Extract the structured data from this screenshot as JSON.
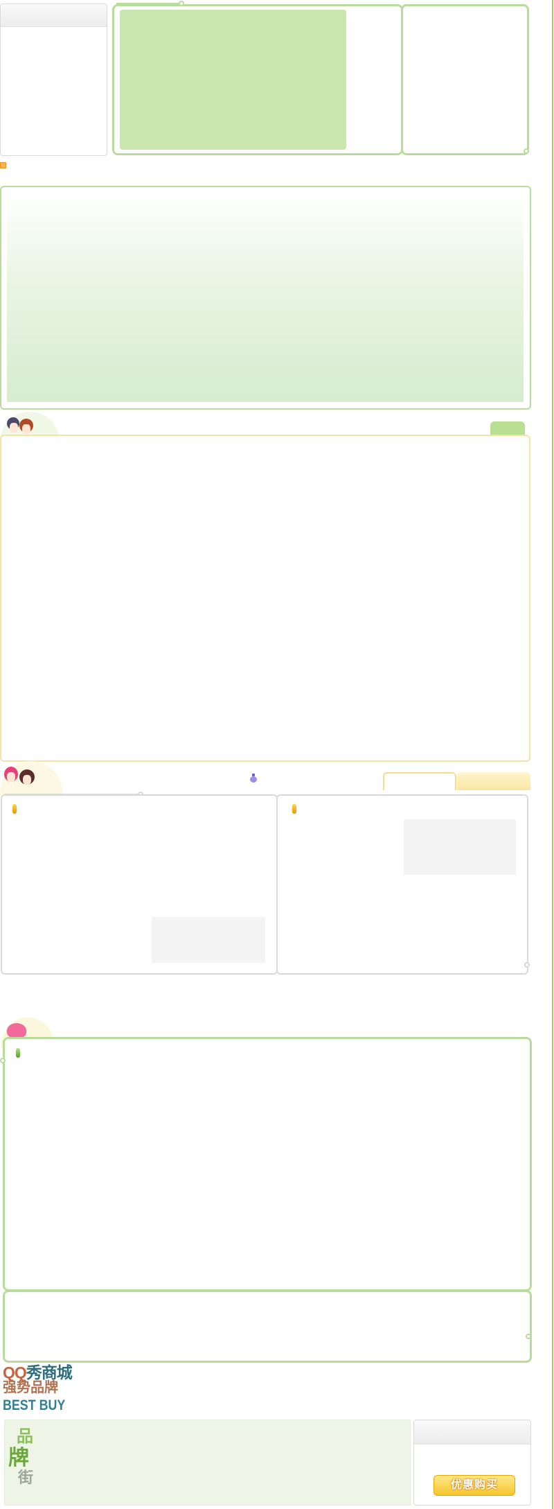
{
  "brand": {
    "line1_a": "QQ",
    "line1_b": "秀商城",
    "line2": "强势品牌",
    "line3": "BEST BUY"
  },
  "brand_street": {
    "char1": "品",
    "char2": "牌",
    "char3": "街"
  },
  "buy_button": {
    "label": "优惠购买"
  },
  "colors": {
    "accent_green": "#b8dc9c",
    "accent_yellow": "#f5e2a8",
    "page_edge": "#a9c46a"
  },
  "icons": {
    "small_orange_marker": "orange-square-icon",
    "bottle_icon": "perfume-bottle-icon"
  }
}
